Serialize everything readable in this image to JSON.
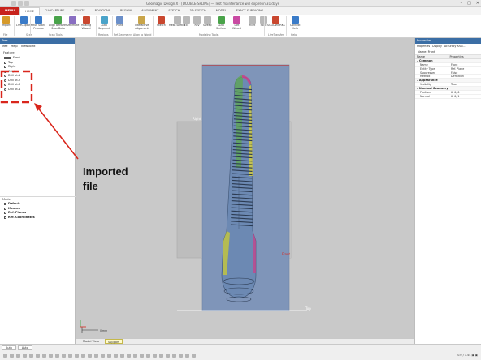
{
  "window": {
    "title": "Geomagic Design X - [DOUBLE-SPLINE] — Test maintenance will expire in 31 days",
    "controls": [
      "–",
      "□",
      "✕"
    ]
  },
  "tabs": [
    {
      "label": "MENU"
    },
    {
      "label": "HOME"
    },
    {
      "label": "CLV/CAPTURE"
    },
    {
      "label": "POINTS"
    },
    {
      "label": "POLYGONS"
    },
    {
      "label": "REGION"
    },
    {
      "label": "ALIGNMENT"
    },
    {
      "label": "SKETCH"
    },
    {
      "label": "3D SKETCH"
    },
    {
      "label": "MODEL"
    },
    {
      "label": "EXACT SURFACING"
    }
  ],
  "ribbon": {
    "buttons": [
      {
        "label": "Import",
        "color": "#d69a2a"
      },
      {
        "label": "LiveCapture",
        "color": "#3a7bc8"
      },
      {
        "label": "Run Scan\nProcess",
        "color": "#3a7bc8"
      },
      {
        "label": "Align Between\nScan Data",
        "color": "#49a34a"
      },
      {
        "label": "Decimate",
        "color": "#8a6fc2"
      },
      {
        "label": "Healing\nWizard",
        "color": "#c9472f"
      },
      {
        "label": "Auto\nSegment",
        "color": "#4aa3c9"
      },
      {
        "label": "Plane",
        "color": "#6b8fc9"
      },
      {
        "label": "Interactive\nAlignment",
        "color": "#c9a54a"
      },
      {
        "label": "Sketch",
        "color": "#c9472f"
      },
      {
        "label": "Mesh Sketch",
        "color": "#b9b9b9"
      },
      {
        "label": "Ext",
        "color": "#b9b9b9"
      },
      {
        "label": "Rev",
        "color": "#b9b9b9"
      },
      {
        "label": "Sweep",
        "color": "#b9b9b9"
      },
      {
        "label": "Auto\nSurface",
        "color": "#4aa34a"
      },
      {
        "label": "Loft\nWizard",
        "color": "#c94aa3"
      },
      {
        "label": "Fillet",
        "color": "#b9b9b9"
      },
      {
        "label": "Solid",
        "color": "#b9b9b9"
      },
      {
        "label": "SOLIDWORKS",
        "color": "#c9472f"
      },
      {
        "label": "Context\nHelp",
        "color": "#3a7bc8"
      }
    ],
    "groups": [
      "File",
      "Scan",
      "Scan Tools",
      "Regions",
      "Ref.Geometry",
      "Align to World",
      "Modeling Tools",
      "LiveTransfer",
      "Help"
    ]
  },
  "left_panel": {
    "title": "Tree",
    "subtabs": [
      "Tree",
      "Help",
      "Viewpoint"
    ],
    "feature_label": "Feature",
    "items": [
      {
        "label": "Front"
      },
      {
        "label": "Top"
      },
      {
        "label": "Right"
      },
      {
        "label": "Origin"
      },
      {
        "label": "Drill pt-1"
      },
      {
        "label": "Drill pt-2"
      },
      {
        "label": "Drill pt-3"
      },
      {
        "label": "Drill pt-4"
      }
    ],
    "model_title": "Model",
    "model_items": [
      {
        "label": "Default"
      },
      {
        "label": "Meshes"
      },
      {
        "label": "Ref. Planes"
      },
      {
        "label": "Ref. Coordinates"
      }
    ]
  },
  "viewport": {
    "plane_labels": {
      "right": "Right",
      "front": "Front",
      "top": "Top"
    },
    "tabs": [
      {
        "label": "Model View"
      },
      {
        "label": "Support"
      }
    ],
    "scale_label": "0 mm",
    "colors": {
      "background": "#c9c9c9",
      "front_plane": "#7f95b9",
      "side_plane": "#bdbdbd",
      "part": "#6c89b3"
    }
  },
  "right_panel": {
    "title": "Properties",
    "tabs": [
      "Properties",
      "Display",
      "Accuracy Anal..."
    ],
    "name_label": "Name: Front",
    "headers": [
      "Name",
      "Properties"
    ],
    "categories": [
      {
        "name": "Common",
        "rows": [
          {
            "k": "Name",
            "v": "Front"
          },
          {
            "k": "Entity Type",
            "v": "Ref. Plane"
          },
          {
            "k": "Suppressed",
            "v": "False"
          },
          {
            "k": "Method",
            "v": "Definition"
          }
        ]
      },
      {
        "name": "Appearance",
        "rows": [
          {
            "k": "Visibility",
            "v": "True"
          }
        ]
      },
      {
        "name": "Nominal Geometry",
        "rows": [
          {
            "k": "Position",
            "v": "0, 0, 0"
          },
          {
            "k": "Normal",
            "v": "0, 0, 1"
          }
        ]
      }
    ]
  },
  "status": {
    "modes": [
      "Auto",
      "Auto"
    ],
    "right_text": "0.0 / 1.44 ▣ ▣"
  },
  "annotation": {
    "text_line1": "Imported",
    "text_line2": "file",
    "color": "#d9261c"
  }
}
